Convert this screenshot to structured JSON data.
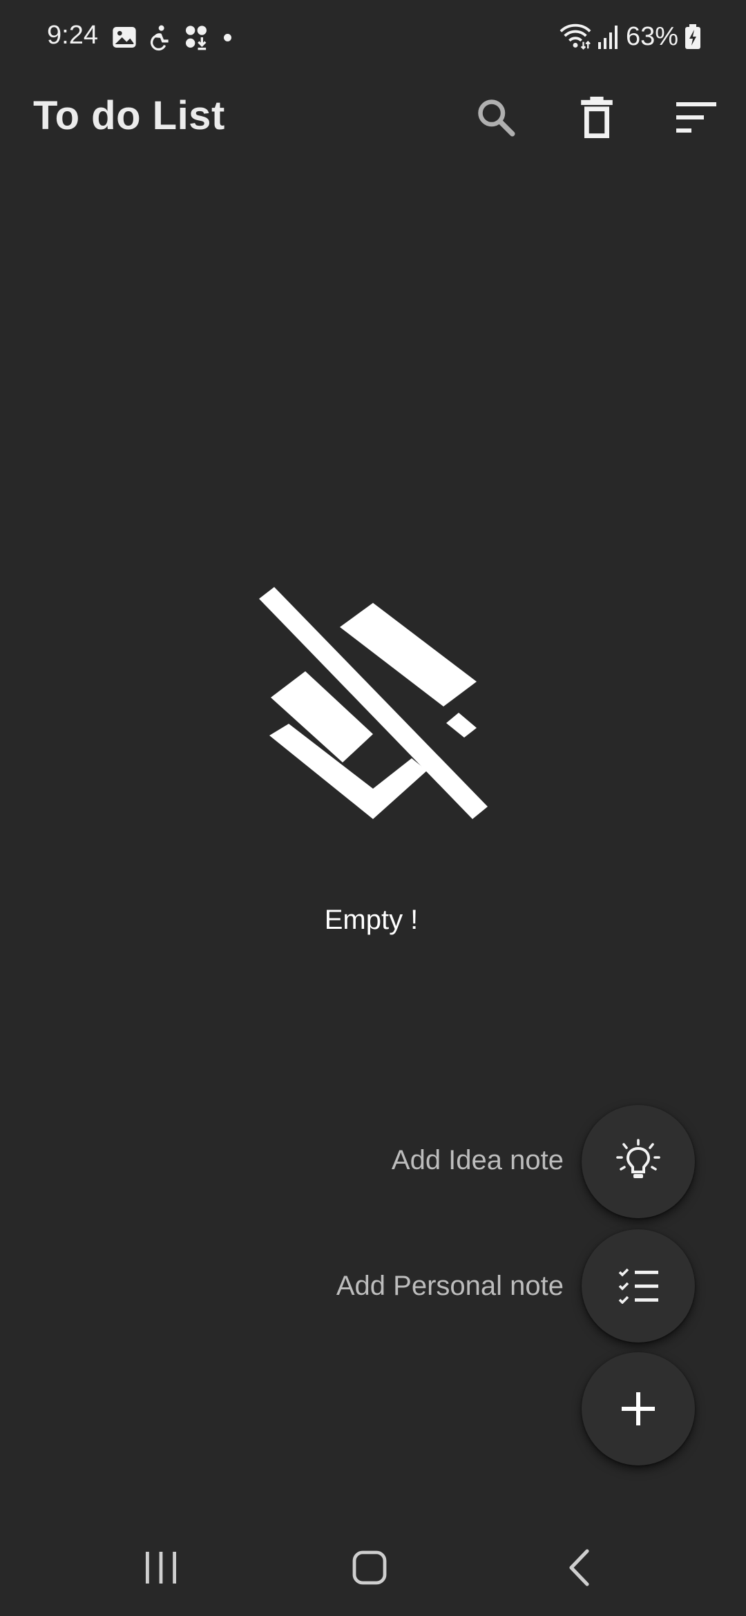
{
  "status_bar": {
    "time": "9:24",
    "battery_percent": "63%",
    "icons": [
      "gallery-icon",
      "accessibility-icon",
      "downloads-icon",
      "notification-dot",
      "wifi-icon",
      "signal-icon",
      "battery-charging-icon"
    ]
  },
  "app_bar": {
    "title": "To do List",
    "actions": [
      "search-icon",
      "trash-icon",
      "sort-icon"
    ]
  },
  "empty_state": {
    "icon": "layers-off-icon",
    "message": "Empty !"
  },
  "fab_menu": {
    "items": [
      {
        "label": "Add Idea note",
        "icon": "lightbulb-icon"
      },
      {
        "label": "Add Personal note",
        "icon": "checklist-icon"
      }
    ],
    "main_icon": "plus-icon"
  },
  "nav_bar": {
    "buttons": [
      "recents-icon",
      "home-icon",
      "back-icon"
    ]
  },
  "colors": {
    "background": "#282828",
    "text_primary": "#ececec",
    "text_secondary": "#bdbdbd",
    "fab_background": "#2f2f2f"
  }
}
